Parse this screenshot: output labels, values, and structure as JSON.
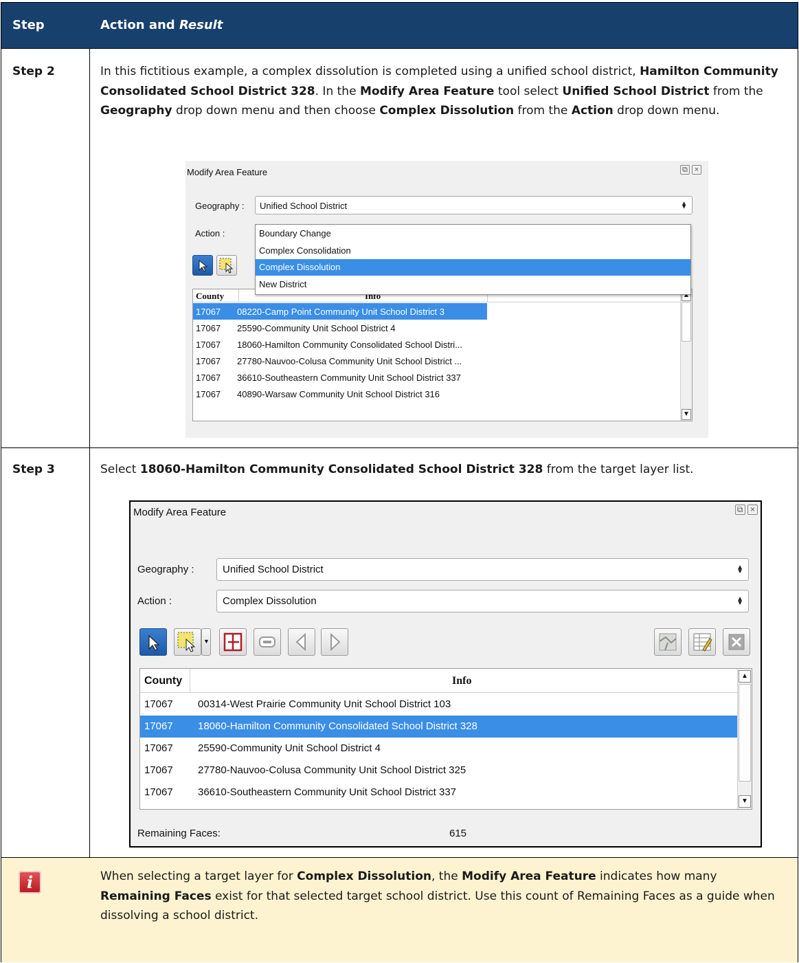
{
  "header": {
    "step": "Step",
    "action": "Action and ",
    "result": "Result"
  },
  "step2": {
    "label": "Step 2",
    "text": {
      "a": "In this fictitious example, a complex dissolution is completed using a unified school district, ",
      "b": "Hamilton Community Consolidated School District 328",
      "c": ". In the ",
      "d": "Modify Area Feature",
      "e": " tool select ",
      "f": "Unified School District",
      "g": " from the ",
      "h": "Geography",
      "i": " drop down menu and then choose ",
      "j": "Complex Dissolution",
      "k": " from the ",
      "l": "Action",
      "m": " drop down menu."
    },
    "panel": {
      "title": "Modify Area Feature",
      "geography_label": "Geography :",
      "geography_value": "Unified School District",
      "action_label": "Action :",
      "dropdown_items": [
        "Boundary Change",
        "Complex Consolidation",
        "Complex Dissolution",
        "New District"
      ],
      "selected_item_index": 2,
      "col_county": "County",
      "col_info": "Info",
      "rows": [
        {
          "county": "17067",
          "info": "08220-Camp Point Community Unit School District 3",
          "selected": true
        },
        {
          "county": "17067",
          "info": "25590-Community Unit School District 4",
          "selected": false
        },
        {
          "county": "17067",
          "info": "18060-Hamilton Community Consolidated School Distri...",
          "selected": false
        },
        {
          "county": "17067",
          "info": "27780-Nauvoo-Colusa Community Unit School District ...",
          "selected": false
        },
        {
          "county": "17067",
          "info": "36610-Southeastern Community Unit School District 337",
          "selected": false
        },
        {
          "county": "17067",
          "info": "40890-Warsaw Community Unit School District 316",
          "selected": false
        }
      ]
    }
  },
  "step3": {
    "label": "Step 3",
    "text": {
      "a": "Select ",
      "b": "18060-Hamilton Community Consolidated School District 328",
      "c": " from the target layer list."
    },
    "panel": {
      "title": "Modify Area Feature",
      "geography_label": "Geography :",
      "geography_value": "Unified School District",
      "action_label": "Action :",
      "action_value": "Complex Dissolution",
      "col_county": "County",
      "col_info": "Info",
      "rows": [
        {
          "county": "17067",
          "info": "00314-West Prairie Community Unit School District 103",
          "selected": false
        },
        {
          "county": "17067",
          "info": "18060-Hamilton Community Consolidated School District 328",
          "selected": true
        },
        {
          "county": "17067",
          "info": "25590-Community Unit School District 4",
          "selected": false
        },
        {
          "county": "17067",
          "info": "27780-Nauvoo-Colusa Community Unit School District 325",
          "selected": false
        },
        {
          "county": "17067",
          "info": "36610-Southeastern Community Unit School District 337",
          "selected": false
        }
      ],
      "remaining_label": "Remaining Faces:",
      "remaining_value": "615"
    }
  },
  "note": {
    "a": "When selecting a target layer for ",
    "b": "Complex Dissolution",
    "c": ", the ",
    "d": "Modify Area Feature",
    "e": " indicates how many ",
    "f": "Remaining Faces",
    "g": " exist for that selected target school district. Use this count of Remaining Faces as a guide when dissolving a school district.",
    "icon_letter": "i"
  },
  "colors": {
    "header_bg": "#17406d",
    "note_bg": "#fef3d1",
    "selection": "#3a8ee6"
  }
}
